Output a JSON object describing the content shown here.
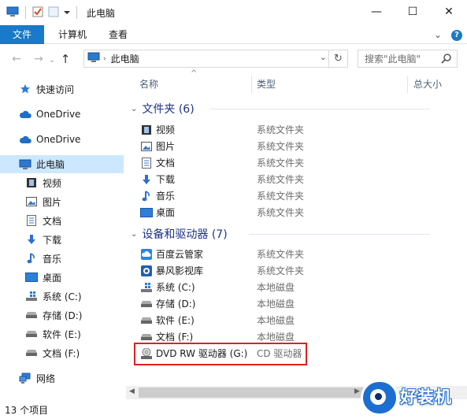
{
  "window": {
    "title": "此电脑",
    "minimize": "—",
    "maximize": "☐",
    "close": "✕"
  },
  "ribbon": {
    "tabs": [
      "文件",
      "计算机",
      "查看"
    ],
    "collapse_glyph": "⌄",
    "help_glyph": "?"
  },
  "address": {
    "breadcrumb": "此电脑",
    "back_glyph": "←",
    "forward_glyph": "→",
    "recent_glyph": "⌄",
    "up_glyph": "↑",
    "dropdown_glyph": "⌄",
    "refresh_glyph": "↻"
  },
  "search": {
    "placeholder": "搜索\"此电脑\""
  },
  "nav": {
    "items": [
      {
        "label": "快速访问",
        "icon": "star-icon"
      },
      {
        "label": "OneDrive",
        "icon": "cloud-icon"
      },
      {
        "label": "OneDrive",
        "icon": "cloud-icon"
      },
      {
        "label": "此电脑",
        "icon": "computer-icon"
      },
      {
        "label": "视频",
        "icon": "video-icon"
      },
      {
        "label": "图片",
        "icon": "picture-icon"
      },
      {
        "label": "文档",
        "icon": "document-icon"
      },
      {
        "label": "下载",
        "icon": "download-icon"
      },
      {
        "label": "音乐",
        "icon": "music-icon"
      },
      {
        "label": "桌面",
        "icon": "desktop-icon"
      },
      {
        "label": "系统 (C:)",
        "icon": "drive-icon"
      },
      {
        "label": "存储 (D:)",
        "icon": "drive-icon"
      },
      {
        "label": "软件 (E:)",
        "icon": "drive-icon"
      },
      {
        "label": "文档 (F:)",
        "icon": "drive-icon"
      },
      {
        "label": "网络",
        "icon": "network-icon"
      }
    ]
  },
  "columns": {
    "name": "名称",
    "type": "类型",
    "size": "总大小",
    "sort_glyph": "^"
  },
  "groups": [
    {
      "title": "文件夹 (6)",
      "items": [
        {
          "name": "视频",
          "type": "系统文件夹",
          "icon": "video-icon"
        },
        {
          "name": "图片",
          "type": "系统文件夹",
          "icon": "picture-icon"
        },
        {
          "name": "文档",
          "type": "系统文件夹",
          "icon": "document-icon"
        },
        {
          "name": "下载",
          "type": "系统文件夹",
          "icon": "download-icon"
        },
        {
          "name": "音乐",
          "type": "系统文件夹",
          "icon": "music-icon"
        },
        {
          "name": "桌面",
          "type": "系统文件夹",
          "icon": "desktop-icon"
        }
      ]
    },
    {
      "title": "设备和驱动器 (7)",
      "items": [
        {
          "name": "百度云管家",
          "type": "系统文件夹",
          "icon": "baidu-cloud-icon"
        },
        {
          "name": "暴风影视库",
          "type": "系统文件夹",
          "icon": "media-library-icon"
        },
        {
          "name": "系统 (C:)",
          "type": "本地磁盘",
          "icon": "drive-icon"
        },
        {
          "name": "存储 (D:)",
          "type": "本地磁盘",
          "icon": "drive-icon"
        },
        {
          "name": "软件 (E:)",
          "type": "本地磁盘",
          "icon": "drive-icon"
        },
        {
          "name": "文档 (F:)",
          "type": "本地磁盘",
          "icon": "drive-icon"
        },
        {
          "name": "DVD RW 驱动器 (G:)",
          "type": "CD 驱动器",
          "icon": "dvd-drive-icon"
        }
      ]
    }
  ],
  "group_chevron": "⌄",
  "scroll": {
    "left_glyph": "◀",
    "right_glyph": "▶"
  },
  "status": {
    "item_count": "13 个项目"
  },
  "watermark": {
    "text": "好装机"
  },
  "colors": {
    "accent": "#1979ca",
    "selection": "#cce8ff",
    "group_title": "#1e3287",
    "highlight_border": "#e02020"
  }
}
